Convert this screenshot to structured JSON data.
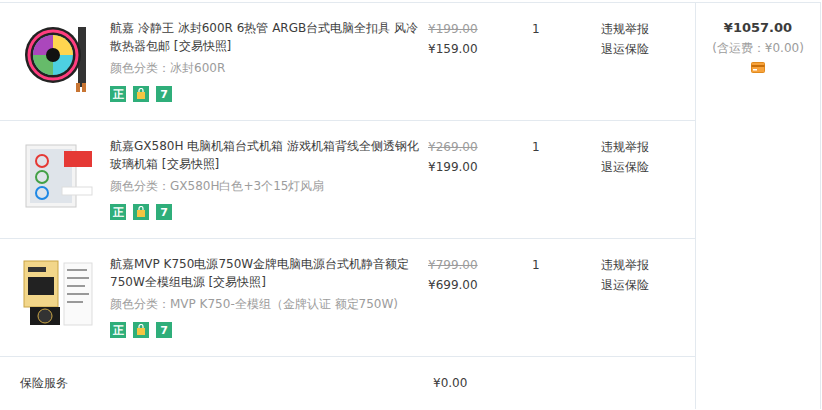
{
  "items": [
    {
      "title": "航嘉 冷静王 冰封600R 6热管 ARGB台式电脑全扣具 风冷散热器包邮",
      "snapshot": "[交易快照]",
      "sku": "颜色分类：冰封600R",
      "original_price": "¥199.00",
      "price": "¥159.00",
      "quantity": "1",
      "actions": [
        "违规举报",
        "退运保险"
      ],
      "badges": [
        "正",
        "7"
      ]
    },
    {
      "title": "航嘉GX580H 电脑机箱台式机箱 游戏机箱背线全侧透钢化玻璃机箱",
      "snapshot": "[交易快照]",
      "sku": "颜色分类：GX580H白色+3个15灯风扇",
      "original_price": "¥269.00",
      "price": "¥199.00",
      "quantity": "1",
      "actions": [
        "违规举报",
        "退运保险"
      ],
      "badges": [
        "正",
        "7"
      ]
    },
    {
      "title": "航嘉MVP K750电源750W金牌电脑电源台式机静音额定750W全模组电源",
      "snapshot": "[交易快照]",
      "sku": "颜色分类：MVP K750-全模组（金牌认证 额定750W)",
      "original_price": "¥799.00",
      "price": "¥699.00",
      "quantity": "1",
      "actions": [
        "违规举报",
        "退运保险"
      ],
      "badges": [
        "正",
        "7"
      ]
    }
  ],
  "order_total": {
    "amount": "¥1057.00",
    "shipping_note": "(含运费：¥0.00)"
  },
  "insurance": {
    "label": "保险服务",
    "amount": "¥0.00"
  }
}
